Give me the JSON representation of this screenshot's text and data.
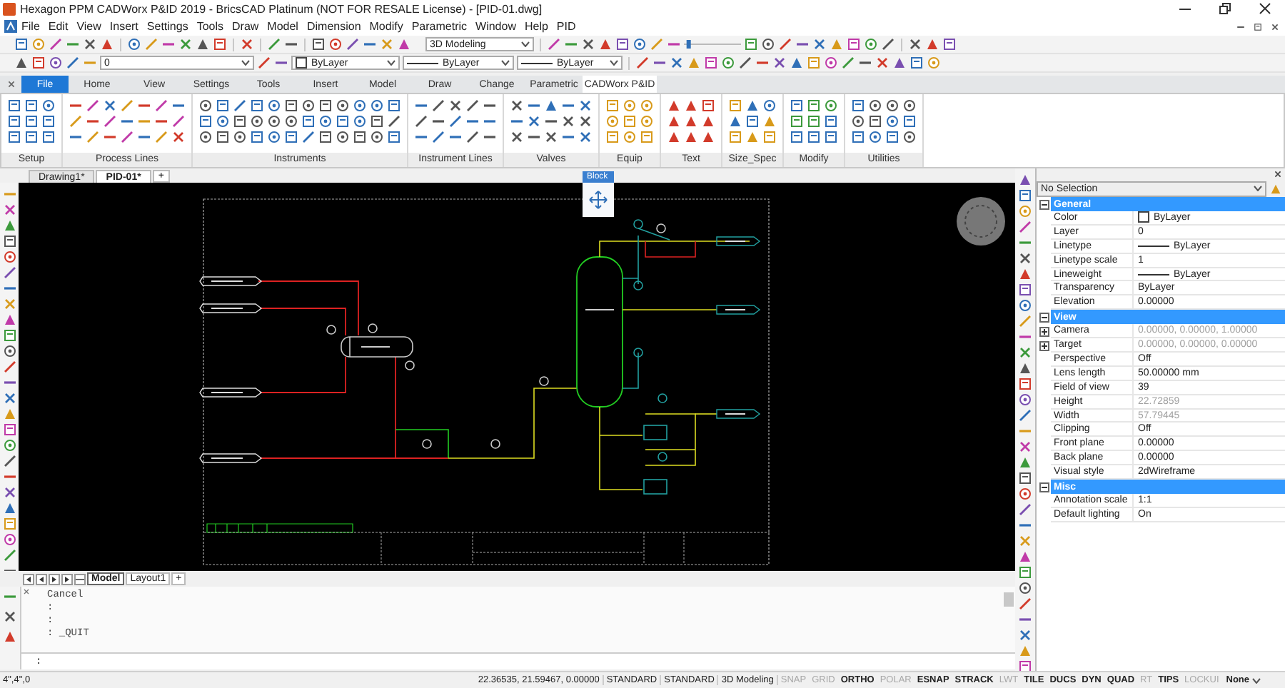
{
  "window": {
    "title": "Hexagon PPM CADWorx P&ID 2019 - BricsCAD Platinum (NOT FOR RESALE License) - [PID-01.dwg]"
  },
  "menu": [
    "File",
    "Edit",
    "View",
    "Insert",
    "Settings",
    "Tools",
    "Draw",
    "Model",
    "Dimension",
    "Modify",
    "Parametric",
    "Window",
    "Help",
    "PID"
  ],
  "toolbar": {
    "workspace": "3D Modeling",
    "layer": "0",
    "zoom_slider": {
      "level": 0.05
    },
    "color_setting": "ByLayer",
    "linetype": "ByLayer",
    "lineweight": "ByLayer"
  },
  "ribbon": {
    "tabs": [
      {
        "label": "File",
        "kind": "application",
        "selected": false
      },
      {
        "label": "Home",
        "kind": "tab",
        "selected": false
      },
      {
        "label": "View",
        "kind": "tab",
        "selected": false
      },
      {
        "label": "Settings",
        "kind": "tab",
        "selected": false
      },
      {
        "label": "Tools",
        "kind": "tab",
        "selected": false
      },
      {
        "label": "Insert",
        "kind": "tab",
        "selected": false
      },
      {
        "label": "Model",
        "kind": "tab",
        "selected": false
      },
      {
        "label": "Draw",
        "kind": "tab",
        "selected": false
      },
      {
        "label": "Change",
        "kind": "tab",
        "selected": false
      },
      {
        "label": "Parametric",
        "kind": "tab",
        "selected": false
      },
      {
        "label": "CADWorx P&ID",
        "kind": "tab",
        "selected": true
      }
    ],
    "groups": [
      {
        "label": "Setup"
      },
      {
        "label": "Process Lines"
      },
      {
        "label": "Instruments"
      },
      {
        "label": "Instrument Lines"
      },
      {
        "label": "Valves"
      },
      {
        "label": "Equip"
      },
      {
        "label": "Text"
      },
      {
        "label": "Size_Spec"
      },
      {
        "label": "Modify"
      },
      {
        "label": "Utilities"
      }
    ]
  },
  "documents": [
    {
      "label": "Drawing1*",
      "selected": false
    },
    {
      "label": "PID-01*",
      "selected": true
    }
  ],
  "new_document_tab": "+",
  "canvas": {
    "tooltip": "Block"
  },
  "layout_tabs": [
    {
      "label": "Model",
      "selected": true
    },
    {
      "label": "Layout1",
      "selected": false
    }
  ],
  "new_layout_tab": "+",
  "command": {
    "history": [
      "Cancel",
      ":",
      ":",
      ": _QUIT"
    ],
    "prompt": ":"
  },
  "properties": {
    "selection": "No Selection",
    "sections": [
      {
        "title": "General",
        "expanded": true,
        "rows": [
          {
            "label": "Color",
            "value": "ByLayer",
            "kind": "color",
            "disabled": false
          },
          {
            "label": "Layer",
            "value": "0",
            "kind": "text",
            "disabled": false
          },
          {
            "label": "Linetype",
            "value": "ByLayer",
            "kind": "line",
            "disabled": false
          },
          {
            "label": "Linetype scale",
            "value": "1",
            "kind": "text",
            "disabled": false
          },
          {
            "label": "Lineweight",
            "value": "ByLayer",
            "kind": "line",
            "disabled": false
          },
          {
            "label": "Transparency",
            "value": "ByLayer",
            "kind": "text",
            "disabled": false
          },
          {
            "label": "Elevation",
            "value": "0.00000",
            "kind": "text",
            "disabled": false
          }
        ]
      },
      {
        "title": "View",
        "expanded": true,
        "rows": [
          {
            "label": "Camera",
            "value": "0.00000, 0.00000, 1.00000",
            "kind": "group",
            "expanded": false,
            "disabled": true
          },
          {
            "label": "Target",
            "value": "0.00000, 0.00000, 0.00000",
            "kind": "group",
            "expanded": false,
            "disabled": true
          },
          {
            "label": "Perspective",
            "value": "Off",
            "kind": "text",
            "disabled": false
          },
          {
            "label": "Lens length",
            "value": "50.00000 mm",
            "kind": "text",
            "disabled": false
          },
          {
            "label": "Field of view",
            "value": "39",
            "kind": "text",
            "disabled": false
          },
          {
            "label": "Height",
            "value": "22.72859",
            "kind": "text",
            "disabled": true
          },
          {
            "label": "Width",
            "value": "57.79445",
            "kind": "text",
            "disabled": true
          },
          {
            "label": "Clipping",
            "value": "Off",
            "kind": "text",
            "disabled": false
          },
          {
            "label": "Front plane",
            "value": "0.00000",
            "kind": "text",
            "disabled": false
          },
          {
            "label": "Back plane",
            "value": "0.00000",
            "kind": "text",
            "disabled": false
          },
          {
            "label": "Visual style",
            "value": "2dWireframe",
            "kind": "text",
            "disabled": false
          }
        ]
      },
      {
        "title": "Misc",
        "expanded": true,
        "rows": [
          {
            "label": "Annotation scale",
            "value": "1:1",
            "kind": "text",
            "disabled": false
          },
          {
            "label": "Default lighting",
            "value": "On",
            "kind": "text",
            "disabled": false
          }
        ]
      }
    ]
  },
  "status_bar": {
    "cursor": "4\",4\",0",
    "coordinates": "22.36535, 21.59467, 0.00000",
    "fields": [
      "STANDARD",
      "STANDARD",
      "3D Modeling"
    ],
    "toggles": [
      {
        "label": "SNAP",
        "on": false
      },
      {
        "label": "GRID",
        "on": false
      },
      {
        "label": "ORTHO",
        "on": true
      },
      {
        "label": "POLAR",
        "on": false
      },
      {
        "label": "ESNAP",
        "on": true
      },
      {
        "label": "STRACK",
        "on": true
      },
      {
        "label": "LWT",
        "on": false
      },
      {
        "label": "TILE",
        "on": true
      },
      {
        "label": "DUCS",
        "on": true
      },
      {
        "label": "DYN",
        "on": true
      },
      {
        "label": "QUAD",
        "on": true
      },
      {
        "label": "RT",
        "on": false
      },
      {
        "label": "TIPS",
        "on": true
      },
      {
        "label": "LOCKUI",
        "on": false
      }
    ],
    "dropdown": "None"
  }
}
